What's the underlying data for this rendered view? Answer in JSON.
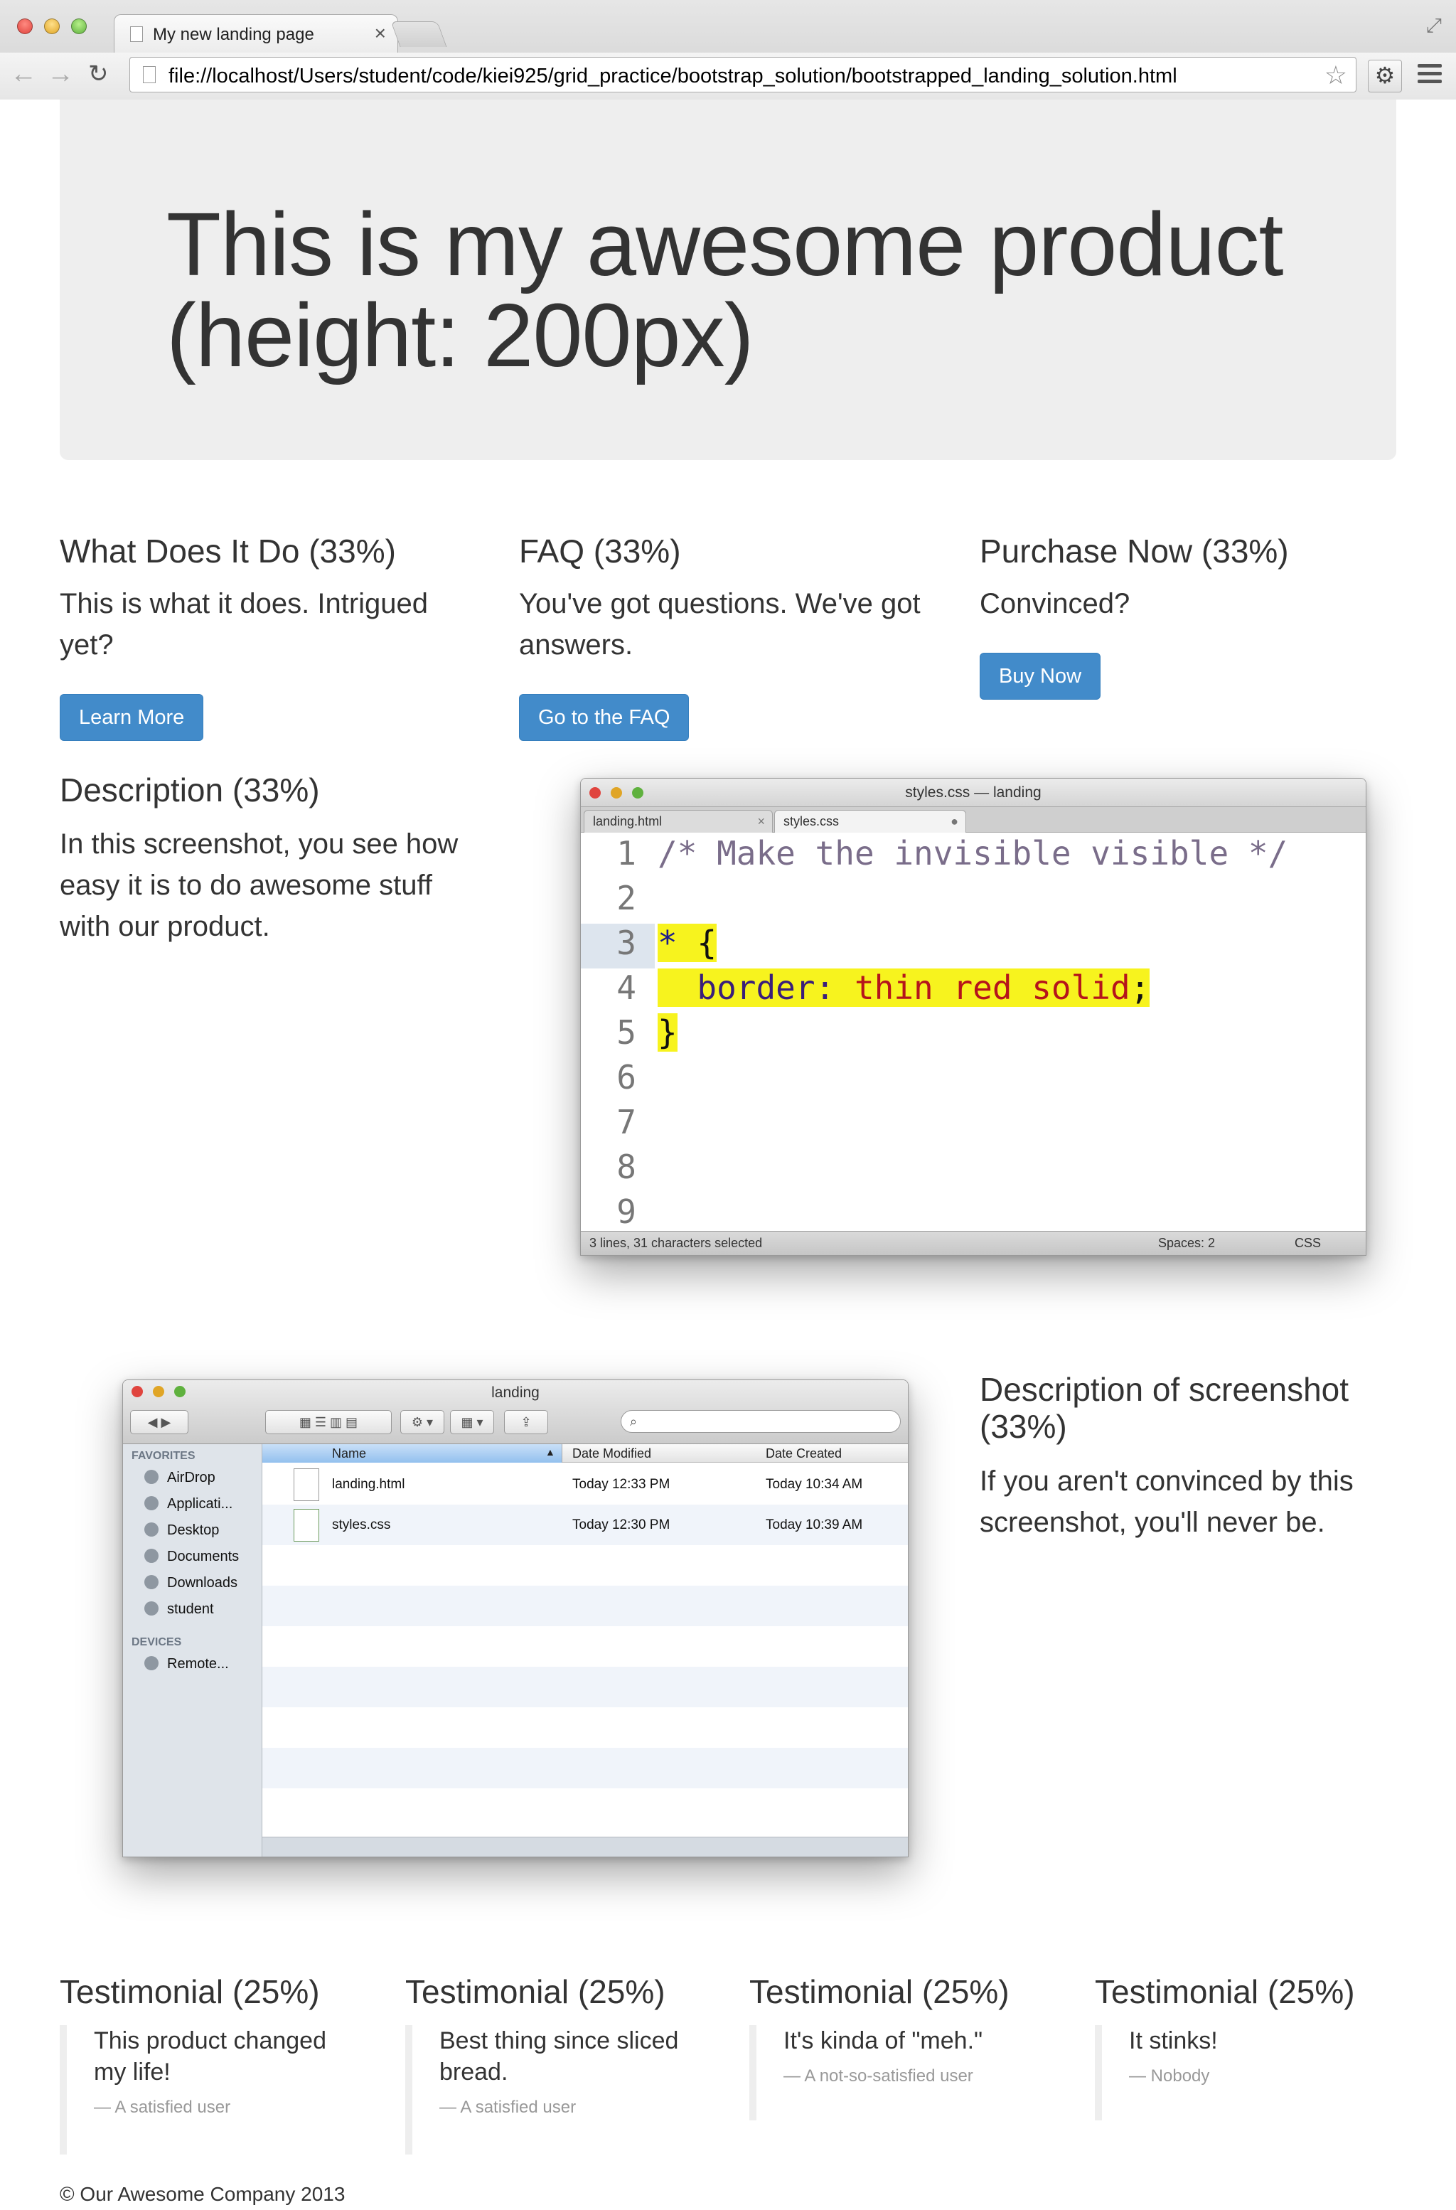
{
  "browser": {
    "tab_title": "My new landing page",
    "url": "file://localhost/Users/student/code/kiei925/grid_practice/bootstrap_solution/bootstrapped_landing_solution.html",
    "icons": [
      "back-arrow-icon",
      "forward-arrow-icon",
      "reload-icon",
      "star-icon",
      "gear-icon",
      "menu-icon"
    ]
  },
  "hero": {
    "title": "This is my awesome product (height: 200px)"
  },
  "columns": [
    {
      "heading": "What Does It Do (33%)",
      "text": "This is what it does. Intrigued yet?",
      "button": "Learn More"
    },
    {
      "heading": "FAQ (33%)",
      "text": "You've got questions. We've got answers.",
      "button": "Go to the FAQ"
    },
    {
      "heading": "Purchase Now (33%)",
      "text": "Convinced?",
      "button": "Buy Now"
    }
  ],
  "description": {
    "heading": "Description (33%)",
    "text": "In this screenshot, you see how easy it is to do awesome stuff with our product."
  },
  "editor": {
    "title": "styles.css — landing",
    "tabs": [
      "landing.html",
      "styles.css"
    ],
    "line_numbers": [
      "1",
      "2",
      "3",
      "4",
      "5",
      "6",
      "7",
      "8",
      "9"
    ],
    "code": {
      "comment": "/* Make the invisible visible */",
      "selector": "*",
      "open_brace": " {",
      "property": "border:",
      "value": "thin red solid",
      "semicolon": ";",
      "close_brace": "}"
    },
    "status_left": "3 lines, 31 characters selected",
    "status_spaces": "Spaces: 2",
    "status_syntax": "CSS"
  },
  "finder": {
    "title": "landing",
    "favorites_label": "FAVORITES",
    "favorites": [
      "AirDrop",
      "Applicati...",
      "Desktop",
      "Documents",
      "Downloads",
      "student"
    ],
    "devices_label": "DEVICES",
    "devices": [
      "Remote..."
    ],
    "columns": [
      "Name",
      "Date Modified",
      "Date Created"
    ],
    "files": [
      {
        "name": "landing.html",
        "modified": "Today 12:33 PM",
        "created": "Today 10:34 AM"
      },
      {
        "name": "styles.css",
        "modified": "Today 12:30 PM",
        "created": "Today 10:39 AM"
      }
    ]
  },
  "screenshot_description": {
    "heading": "Description of screenshot (33%)",
    "text": "If you aren't convinced by this screenshot, you'll never be."
  },
  "testimonials": [
    {
      "heading": "Testimonial (25%)",
      "quote": "This product changed my life!",
      "cite": "— A satisfied user"
    },
    {
      "heading": "Testimonial (25%)",
      "quote": "Best thing since sliced bread.",
      "cite": "— A satisfied user"
    },
    {
      "heading": "Testimonial (25%)",
      "quote": "It's kinda of \"meh.\"",
      "cite": "— A not-so-satisfied user"
    },
    {
      "heading": "Testimonial (25%)",
      "quote": "It stinks!",
      "cite": "— Nobody"
    }
  ],
  "footer": "© Our Awesome Company 2013",
  "colors": {
    "button": "#428bca",
    "jumbotron": "#eeeeee",
    "selection": "#f7f31e"
  }
}
